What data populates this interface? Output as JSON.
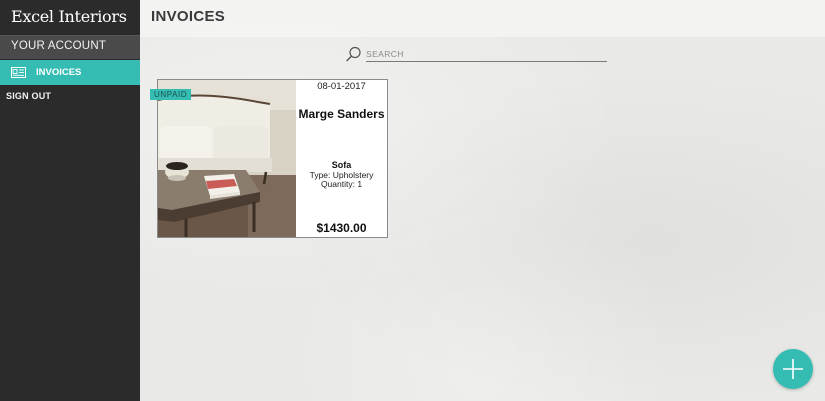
{
  "app": {
    "brand": "Excel Interiors",
    "accent": "#36bdb3"
  },
  "sidebar": {
    "account_label": "YOUR ACCOUNT",
    "invoices_label": "INVOICES",
    "signout_label": "SIGN OUT"
  },
  "header": {
    "title": "INVOICES"
  },
  "search": {
    "placeholder": "SEARCH",
    "value": ""
  },
  "invoices": [
    {
      "status": "UNPAID",
      "date": "08-01-2017",
      "customer": "Marge Sanders",
      "item": "Sofa",
      "type": "Type: Upholstery",
      "quantity": "Quantity: 1",
      "amount": "$1430.00",
      "image": "living-room-sofa-photo"
    }
  ],
  "fab": {
    "icon": "plus-icon"
  }
}
